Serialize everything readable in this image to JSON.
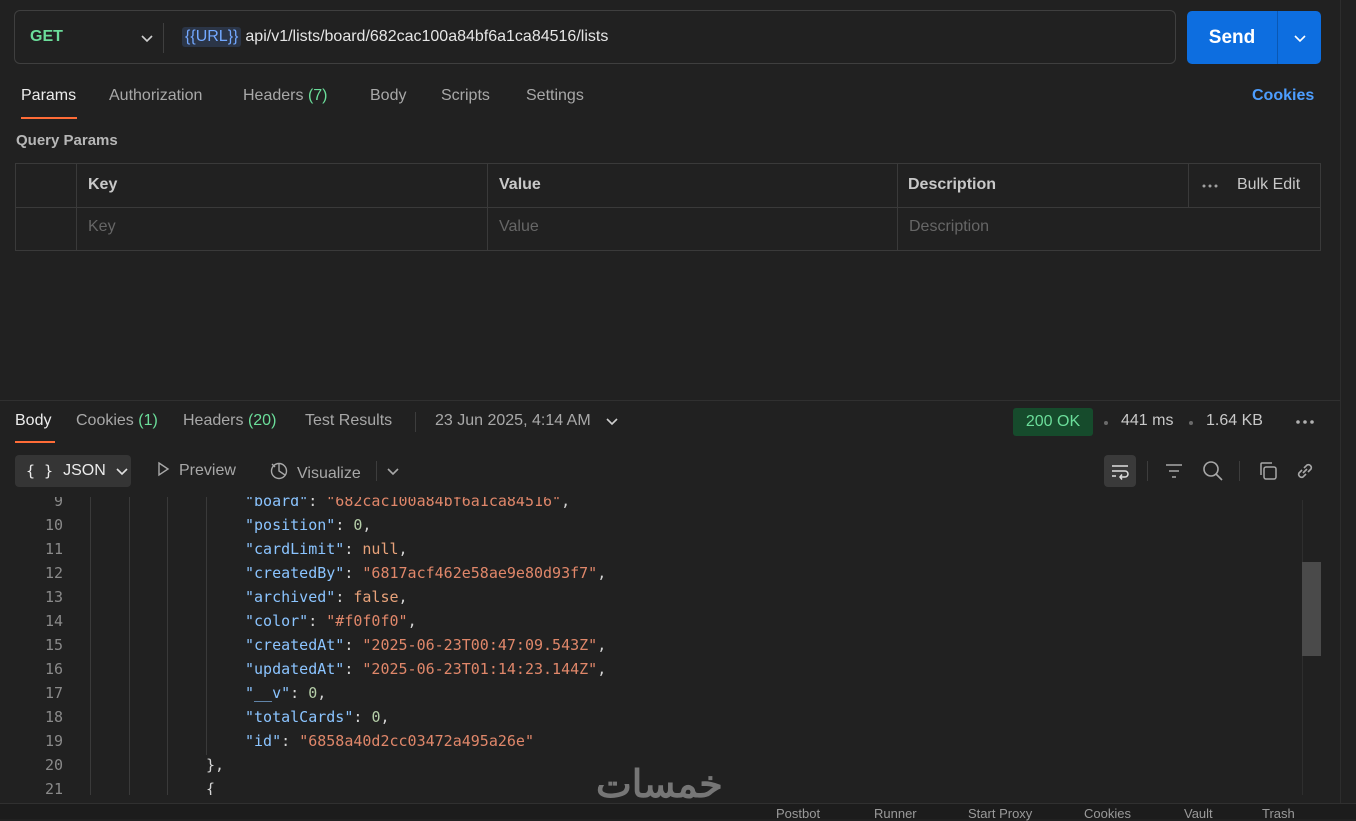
{
  "request": {
    "method": "GET",
    "url_variable": "{{URL}}",
    "url_path": "api/v1/lists/board/682cac100a84bf6a1ca84516/lists",
    "send_label": "Send"
  },
  "request_tabs": [
    {
      "label": "Params",
      "count": ""
    },
    {
      "label": "Authorization",
      "count": ""
    },
    {
      "label": "Headers",
      "count": "(7)"
    },
    {
      "label": "Body",
      "count": ""
    },
    {
      "label": "Scripts",
      "count": ""
    },
    {
      "label": "Settings",
      "count": ""
    }
  ],
  "cookies_link": "Cookies",
  "query_params": {
    "title": "Query Params",
    "headers": {
      "key": "Key",
      "value": "Value",
      "description": "Description",
      "bulk_edit": "Bulk Edit"
    },
    "placeholders": {
      "key": "Key",
      "value": "Value",
      "description": "Description"
    }
  },
  "response_tabs": [
    {
      "label": "Body",
      "count": ""
    },
    {
      "label": "Cookies",
      "count": "(1)"
    },
    {
      "label": "Headers",
      "count": "(20)"
    },
    {
      "label": "Test Results",
      "count": ""
    }
  ],
  "response_meta": {
    "timestamp": "23 Jun 2025, 4:14 AM",
    "status": "200 OK",
    "time": "441 ms",
    "size": "1.64 KB"
  },
  "toolbar": {
    "format": "JSON",
    "format_icon": "{ }",
    "preview": "Preview",
    "visualize": "Visualize"
  },
  "code_lines": [
    {
      "num": "9",
      "key": "\"board\"",
      "sep": ": ",
      "value": "\"682cac100a84bf6a1ca84516\"",
      "vtype": "s",
      "tail": ","
    },
    {
      "num": "10",
      "key": "\"position\"",
      "sep": ": ",
      "value": "0",
      "vtype": "n",
      "tail": ","
    },
    {
      "num": "11",
      "key": "\"cardLimit\"",
      "sep": ": ",
      "value": "null",
      "vtype": "b",
      "tail": ","
    },
    {
      "num": "12",
      "key": "\"createdBy\"",
      "sep": ": ",
      "value": "\"6817acf462e58ae9e80d93f7\"",
      "vtype": "s",
      "tail": ","
    },
    {
      "num": "13",
      "key": "\"archived\"",
      "sep": ": ",
      "value": "false",
      "vtype": "b",
      "tail": ","
    },
    {
      "num": "14",
      "key": "\"color\"",
      "sep": ": ",
      "value": "\"#f0f0f0\"",
      "vtype": "s",
      "tail": ","
    },
    {
      "num": "15",
      "key": "\"createdAt\"",
      "sep": ": ",
      "value": "\"2025-06-23T00:47:09.543Z\"",
      "vtype": "s",
      "tail": ","
    },
    {
      "num": "16",
      "key": "\"updatedAt\"",
      "sep": ": ",
      "value": "\"2025-06-23T01:14:23.144Z\"",
      "vtype": "s",
      "tail": ","
    },
    {
      "num": "17",
      "key": "\"__v\"",
      "sep": ": ",
      "value": "0",
      "vtype": "n",
      "tail": ","
    },
    {
      "num": "18",
      "key": "\"totalCards\"",
      "sep": ": ",
      "value": "0",
      "vtype": "n",
      "tail": ","
    },
    {
      "num": "19",
      "key": "\"id\"",
      "sep": ": ",
      "value": "\"6858a40d2cc03472a495a26e\"",
      "vtype": "s",
      "tail": ""
    },
    {
      "num": "20",
      "key": "",
      "sep": "",
      "value": "},",
      "vtype": "p",
      "tail": ""
    },
    {
      "num": "21",
      "key": "",
      "sep": "",
      "value": "{",
      "vtype": "p",
      "tail": ""
    }
  ],
  "footer": [
    "Postbot",
    "Runner",
    "Start Proxy",
    "Cookies",
    "Vault",
    "Trash"
  ],
  "watermark": "خمسات",
  "colors": {
    "accent": "#ff6c37",
    "send": "#0d6ee0",
    "status_ok": "#6bdd9a",
    "link": "#4d9eff"
  }
}
